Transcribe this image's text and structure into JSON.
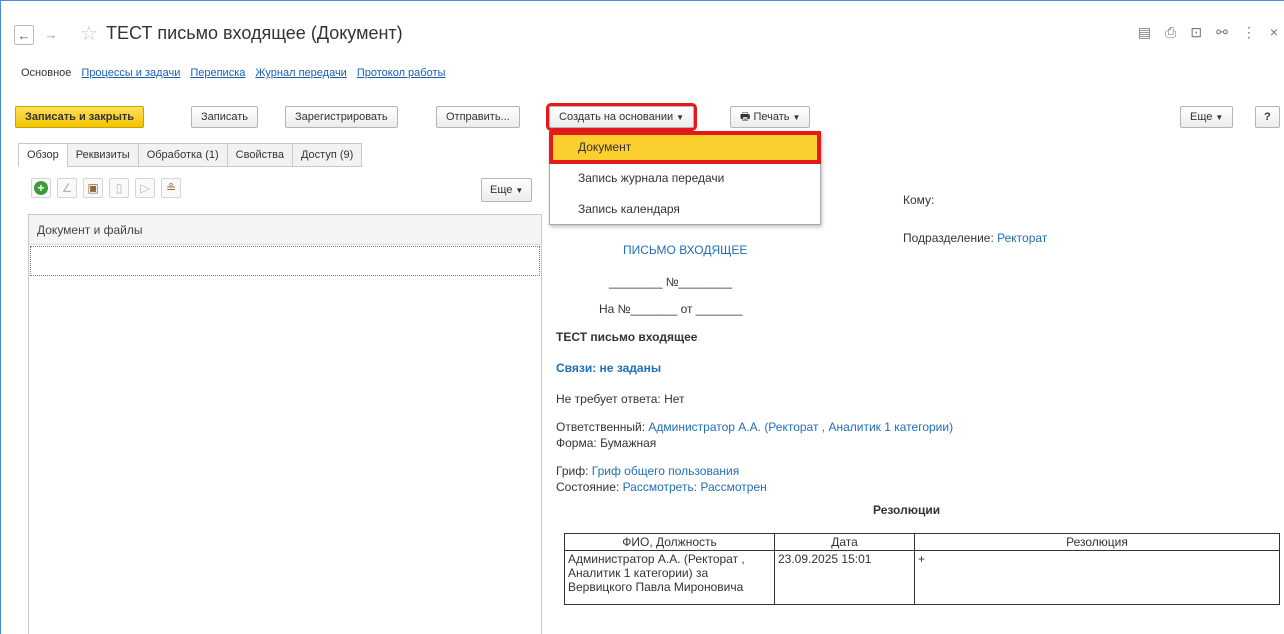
{
  "window": {
    "title": "ТЕСТ письмо входящее (Документ)",
    "icons": [
      "save-icon",
      "print-icon",
      "preview-icon",
      "link-icon",
      "more-vertical-icon",
      "close-icon"
    ]
  },
  "section_nav": {
    "active": "Основное",
    "links": [
      "Процессы и задачи",
      "Переписка",
      "Журнал передачи",
      "Протокол работы"
    ]
  },
  "toolbar": {
    "save_close": "Записать и закрыть",
    "save": "Записать",
    "register": "Зарегистрировать",
    "send": "Отправить...",
    "create_based": "Создать на основании",
    "print": "Печать",
    "more": "Еще",
    "help": "?"
  },
  "dropdown": {
    "items": [
      "Документ",
      "Запись журнала передачи",
      "Запись календаря"
    ]
  },
  "tabs": [
    "Обзор",
    "Реквизиты",
    "Обработка (1)",
    "Свойства",
    "Доступ (9)"
  ],
  "left_panel": {
    "more": "Еще",
    "header": "Документ и файлы"
  },
  "document": {
    "to_label": "Кому:",
    "dept_label": "Подразделение:",
    "dept_value": "Ректорат",
    "doc_kind": "ПИСЬМО ВХОДЯЩЕЕ",
    "number_line": "________ №________",
    "ref_line": "На №_______ от _______",
    "heading": "ТЕСТ письмо входящее",
    "links": "Связи: не заданы",
    "reply_label": "Не требует ответа:",
    "reply_value": "Нет",
    "responsible_label": "Ответственный:",
    "responsible_value": "Администратор А.А. (Ректорат , Аналитик 1 категории)",
    "form_label": "Форма:",
    "form_value": "Бумажная",
    "stamp_label": "Гриф:",
    "stamp_value": "Гриф общего пользования",
    "state_label": "Состояние:",
    "state_value": "Рассмотреть: Рассмотрен",
    "resolutions_title": "Резолюции"
  },
  "resolutions": {
    "columns": [
      "ФИО, Должность",
      "Дата",
      "Резолюция"
    ],
    "rows": [
      {
        "person": "Администратор А.А. (Ректорат , Аналитик 1 категории) за Вервицкого Павла Мироновича",
        "date": "23.09.2025 15:01",
        "resolution": "+"
      }
    ]
  }
}
